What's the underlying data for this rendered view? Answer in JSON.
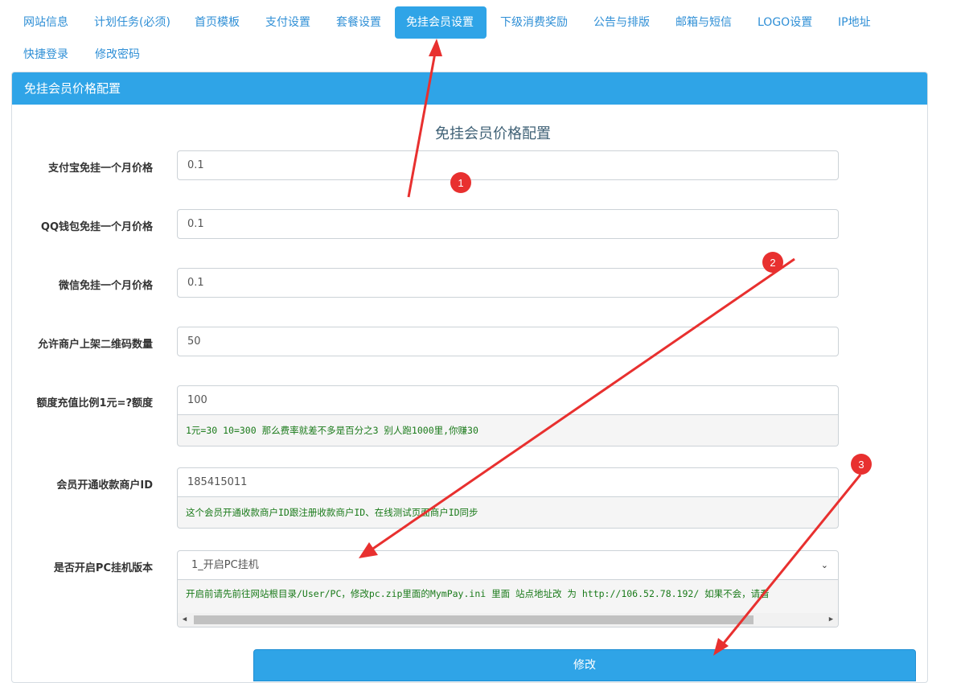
{
  "tabs": [
    {
      "label": "网站信息",
      "active": false
    },
    {
      "label": "计划任务(必须)",
      "active": false
    },
    {
      "label": "首页模板",
      "active": false
    },
    {
      "label": "支付设置",
      "active": false
    },
    {
      "label": "套餐设置",
      "active": false
    },
    {
      "label": "免挂会员设置",
      "active": true
    },
    {
      "label": "下级消费奖励",
      "active": false
    },
    {
      "label": "公告与排版",
      "active": false
    },
    {
      "label": "邮箱与短信",
      "active": false
    },
    {
      "label": "LOGO设置",
      "active": false
    },
    {
      "label": "IP地址",
      "active": false
    },
    {
      "label": "快捷登录",
      "active": false
    },
    {
      "label": "修改密码",
      "active": false
    }
  ],
  "panel": {
    "heading": "免挂会员价格配置",
    "form_title": "免挂会员价格配置"
  },
  "fields": [
    {
      "label": "支付宝免挂一个月价格",
      "value": "0.1"
    },
    {
      "label": "QQ钱包免挂一个月价格",
      "value": "0.1"
    },
    {
      "label": "微信免挂一个月价格",
      "value": "0.1"
    },
    {
      "label": "允许商户上架二维码数量",
      "value": "50"
    },
    {
      "label": "额度充值比例1元=?额度",
      "value": "100",
      "hint": "1元=30  10=300  那么费率就差不多是百分之3 别人跑1000里,你赚30"
    },
    {
      "label": "会员开通收款商户ID",
      "value": "185415011",
      "hint": "这个会员开通收款商户ID跟注册收款商户ID、在线测试页面商户ID同步"
    },
    {
      "label": "是否开启PC挂机版本",
      "value": "1_开启PC挂机",
      "hint": "开启前请先前往网站根目录/User/PC，修改pc.zip里面的MymPay.ini 里面 站点地址改 为 http://106.52.78.192/ 如果不会，请看"
    }
  ],
  "submit_label": "修改",
  "annotations": {
    "badges": [
      "1",
      "2",
      "3"
    ],
    "color": "#e8302f"
  }
}
